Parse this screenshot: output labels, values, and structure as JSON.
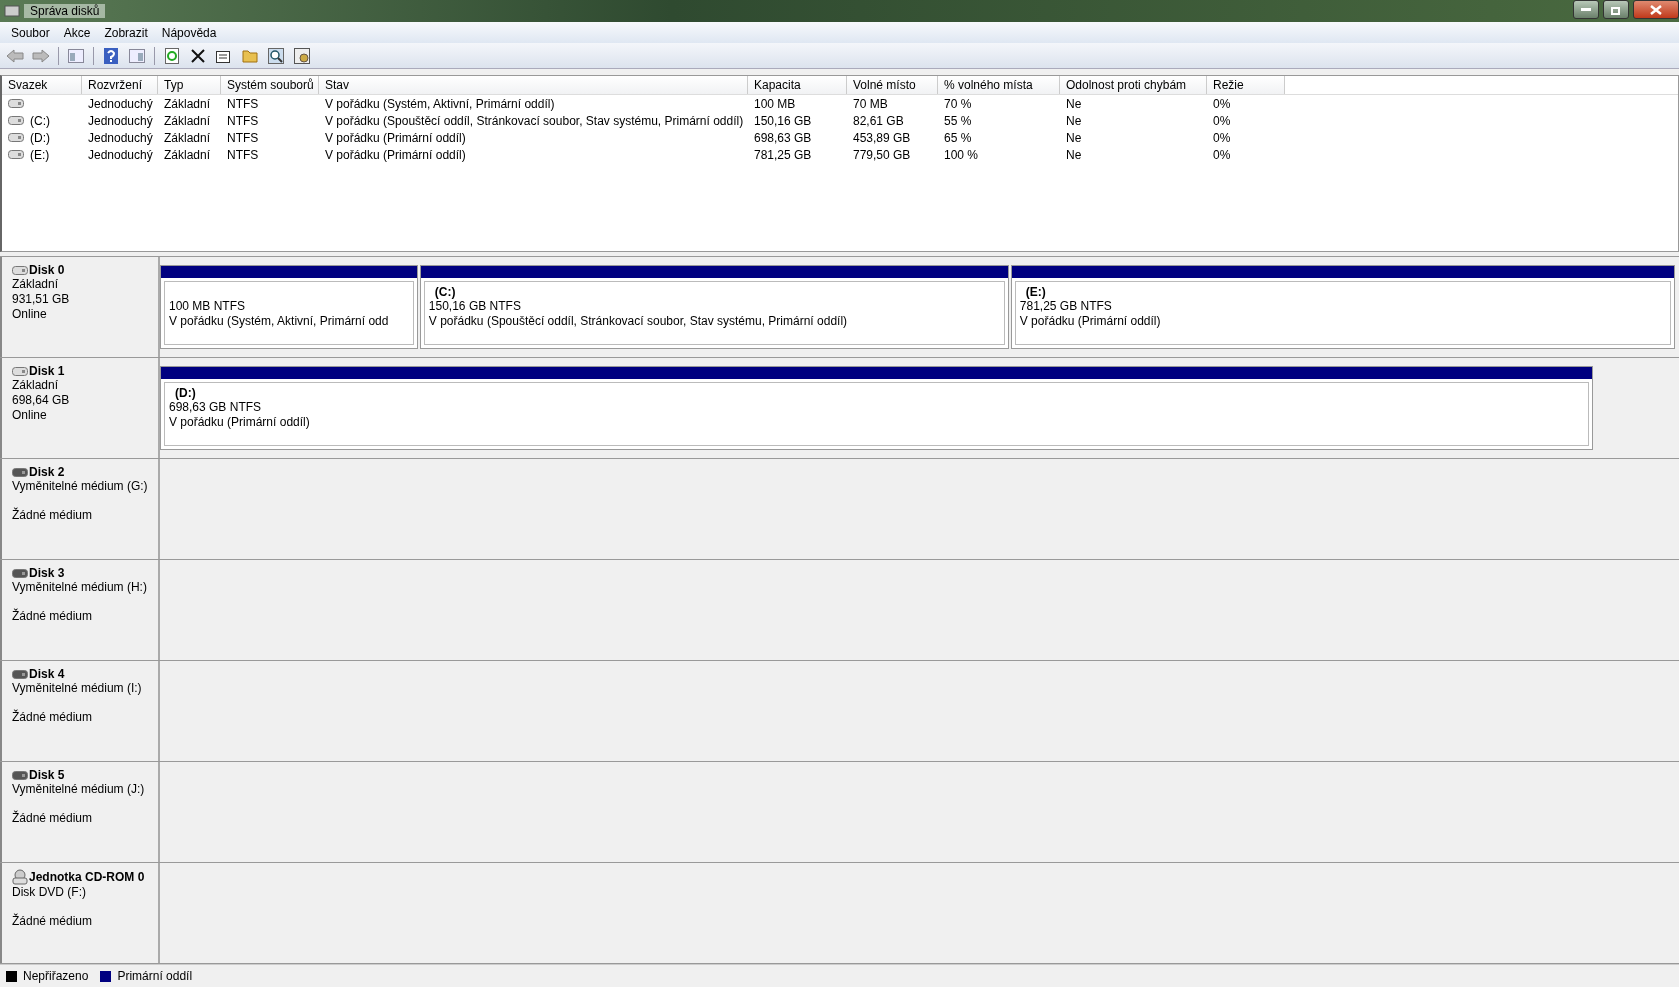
{
  "window": {
    "title": "Správa disků"
  },
  "menu": [
    "Soubor",
    "Akce",
    "Zobrazit",
    "Nápověda"
  ],
  "toolbar": [
    {
      "kind": "back",
      "disabled": true
    },
    {
      "kind": "forward",
      "disabled": true
    },
    {
      "kind": "separator"
    },
    {
      "kind": "tree"
    },
    {
      "kind": "separator"
    },
    {
      "kind": "help"
    },
    {
      "kind": "pane"
    },
    {
      "kind": "separator"
    },
    {
      "kind": "refresh"
    },
    {
      "kind": "delete"
    },
    {
      "kind": "properties"
    },
    {
      "kind": "open"
    },
    {
      "kind": "search"
    },
    {
      "kind": "settings"
    }
  ],
  "table": {
    "columns": [
      "Svazek",
      "Rozvržení",
      "Typ",
      "Systém souborů",
      "Stav",
      "Kapacita",
      "Volné místo",
      "% volného místa",
      "Odolnost proti chybám",
      "Režie"
    ],
    "rows": [
      [
        "",
        "Jednoduchý",
        "Základní",
        "NTFS",
        "V pořádku (Systém, Aktivní, Primární oddíl)",
        "100 MB",
        "70 MB",
        "70 %",
        "Ne",
        "0%"
      ],
      [
        "(C:)",
        "Jednoduchý",
        "Základní",
        "NTFS",
        "V pořádku (Spouštěcí oddíl, Stránkovací soubor, Stav systému, Primární oddíl)",
        "150,16 GB",
        "82,61 GB",
        "55 %",
        "Ne",
        "0%"
      ],
      [
        "(D:)",
        "Jednoduchý",
        "Základní",
        "NTFS",
        "V pořádku (Primární oddíl)",
        "698,63 GB",
        "453,89 GB",
        "65 %",
        "Ne",
        "0%"
      ],
      [
        "(E:)",
        "Jednoduchý",
        "Základní",
        "NTFS",
        "V pořádku (Primární oddíl)",
        "781,25 GB",
        "779,50 GB",
        "100 %",
        "Ne",
        "0%"
      ]
    ]
  },
  "disks": [
    {
      "kind": "hdd",
      "name": "Disk 0",
      "type": "Základní",
      "size": "931,51 GB",
      "status": "Online",
      "partitions": [
        {
          "size": "100 MB NTFS",
          "status": "V pořádku (Systém, Aktivní, Primární odd",
          "color": "#000080"
        },
        {
          "label": "(C:)",
          "size": "150,16 GB NTFS",
          "status": "V pořádku (Spouštěcí oddíl, Stránkovací soubor, Stav systému, Primární oddíl)",
          "color": "#000080"
        },
        {
          "label": "(E:)",
          "size": "781,25 GB NTFS",
          "status": "V pořádku (Primární oddíl)",
          "color": "#000080"
        }
      ]
    },
    {
      "kind": "hdd",
      "name": "Disk 1",
      "type": "Základní",
      "size": "698,64 GB",
      "status": "Online",
      "partitions": [
        {
          "label": "(D:)",
          "size": "698,63 GB NTFS",
          "status": "V pořádku (Primární oddíl)",
          "color": "#000080"
        }
      ]
    },
    {
      "kind": "removable",
      "name": "Disk 2",
      "type": "Vyměnitelné médium (G:)",
      "status": "Žádné médium"
    },
    {
      "kind": "removable",
      "name": "Disk 3",
      "type": "Vyměnitelné médium (H:)",
      "status": "Žádné médium"
    },
    {
      "kind": "removable",
      "name": "Disk 4",
      "type": "Vyměnitelné médium (I:)",
      "status": "Žádné médium"
    },
    {
      "kind": "removable",
      "name": "Disk 5",
      "type": "Vyměnitelné médium (J:)",
      "status": "Žádné médium"
    },
    {
      "kind": "cdrom",
      "name": "Jednotka CD-ROM 0",
      "type": "Disk DVD (F:)",
      "status": "Žádné médium"
    }
  ],
  "legend": [
    {
      "label": "Nepřiřazeno",
      "color": "#000000"
    },
    {
      "label": "Primární oddíl",
      "color": "#000080"
    }
  ]
}
